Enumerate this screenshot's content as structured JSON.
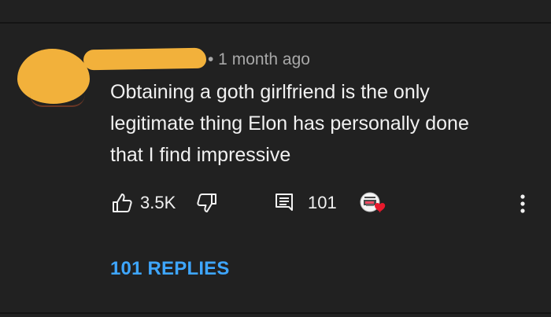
{
  "comment": {
    "timestamp": "• 1 month ago",
    "lines": [
      "Obtaining a goth girlfriend is the only",
      "legitimate thing Elon has personally done",
      "that I find impressive"
    ]
  },
  "actions": {
    "like_count": "3.5K",
    "reply_count": "101"
  },
  "replies_link": "101 REPLIES",
  "icons": {
    "like": "thumbs-up-icon",
    "dislike": "thumbs-down-icon",
    "reply": "comment-icon",
    "creator_heart": "creator-heart-icon",
    "more": "more-vertical-icon"
  },
  "colors": {
    "background": "#212121",
    "primary_text": "#f1f1f1",
    "secondary_text": "#a8a8a8",
    "link": "#3ea6ff",
    "redaction": "#f2b13b",
    "heart": "#e8192c"
  }
}
